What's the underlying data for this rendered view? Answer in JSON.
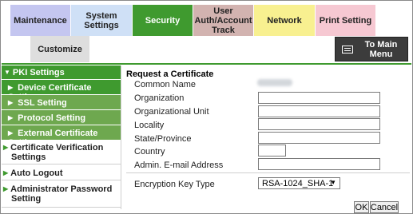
{
  "tabs": {
    "maintenance": "Maintenance",
    "system_settings": "System Settings",
    "security": "Security",
    "user_auth_line1": "User",
    "user_auth_line2": "Auth/Account",
    "user_auth_line3": "Track",
    "network": "Network",
    "print_setting": "Print Setting",
    "customize": "Customize"
  },
  "to_main_menu": {
    "line1": "To Main",
    "line2": "Menu"
  },
  "sidebar": {
    "pki": "PKI Settings",
    "device_cert": "Device Certificate Setting",
    "ssl": "SSL Setting",
    "protocol": "Protocol Setting",
    "external_cert": "External Certificate Setting",
    "cert_verif_line1": "Certificate Verification",
    "cert_verif_line2": "Settings",
    "auto_logout": "Auto Logout",
    "admin_pw_line1": "Administrator Password",
    "admin_pw_line2": "Setting"
  },
  "form": {
    "heading": "Request a Certificate",
    "common_name_label": "Common Name",
    "organization_label": "Organization",
    "organizational_unit_label": "Organizational Unit",
    "locality_label": "Locality",
    "state_label": "State/Province",
    "country_label": "Country",
    "email_label": "Admin. E-mail Address",
    "encryption_label": "Encryption Key Type",
    "encryption_value": "RSA-1024_SHA-1"
  },
  "buttons": {
    "ok": "OK",
    "cancel": "Cancel"
  }
}
